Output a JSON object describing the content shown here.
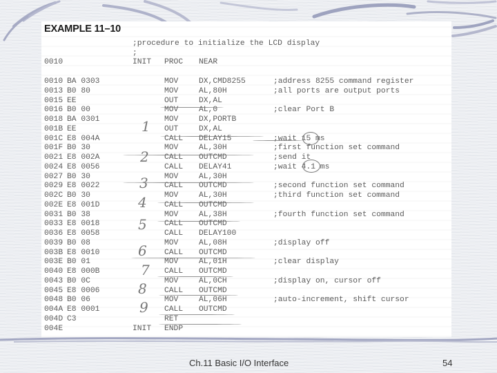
{
  "slide": {
    "example_title": "EXAMPLE 11–10",
    "footer_title": "Ch.11 Basic I/O Interface",
    "page_number": "54"
  },
  "listing": {
    "comment_header": ";procedure to initialize the LCD display",
    "comment_blank": ";",
    "proc_line": {
      "addr": "0010",
      "label": "INIT",
      "op": "PROC",
      "operand": "NEAR"
    },
    "rows": [
      {
        "addr": "0010",
        "code": "BA 0303",
        "op": "MOV",
        "operand": "DX,CMD8255",
        "comment": ";address 8255 command register"
      },
      {
        "addr": "0013",
        "code": "B0 80",
        "op": "MOV",
        "operand": "AL,80H",
        "comment": ";all ports are output ports"
      },
      {
        "addr": "0015",
        "code": "EE",
        "op": "OUT",
        "operand": "DX,AL",
        "comment": ""
      },
      {
        "addr": "0016",
        "code": "B0 00",
        "op": "MOV",
        "operand": "AL,0",
        "comment": ";clear Port B"
      },
      {
        "addr": "0018",
        "code": "BA 0301",
        "op": "MOV",
        "operand": "DX,PORTB",
        "comment": ""
      },
      {
        "addr": "001B",
        "code": "EE",
        "op": "OUT",
        "operand": "DX,AL",
        "comment": ""
      },
      {
        "addr": "001C",
        "code": "E8 004A",
        "op": "CALL",
        "operand": "DELAY15",
        "comment": ";wait 15 ms"
      },
      {
        "addr": "001F",
        "code": "B0 30",
        "op": "MOV",
        "operand": "AL,30H",
        "comment": ";first function set command"
      },
      {
        "addr": "0021",
        "code": "E8 002A",
        "op": "CALL",
        "operand": "OUTCMD",
        "comment": ";send it"
      },
      {
        "addr": "0024",
        "code": "E8 0056",
        "op": "CALL",
        "operand": "DELAY41",
        "comment": ";wait 4.1 ms"
      },
      {
        "addr": "0027",
        "code": "B0 30",
        "op": "MOV",
        "operand": "AL,30H",
        "comment": ""
      },
      {
        "addr": "0029",
        "code": "E8 0022",
        "op": "CALL",
        "operand": "OUTCMD",
        "comment": ";second function set command"
      },
      {
        "addr": "002C",
        "code": "B0 30",
        "op": "MOV",
        "operand": "AL,30H",
        "comment": ";third function set command"
      },
      {
        "addr": "002E",
        "code": "E8 001D",
        "op": "CALL",
        "operand": "OUTCMD",
        "comment": ""
      },
      {
        "addr": "0031",
        "code": "B0 38",
        "op": "MOV",
        "operand": "AL,38H",
        "comment": ";fourth function set command"
      },
      {
        "addr": "0033",
        "code": "E8 0018",
        "op": "CALL",
        "operand": "OUTCMD",
        "comment": ""
      },
      {
        "addr": "0036",
        "code": "E8 0058",
        "op": "CALL",
        "operand": "DELAY100",
        "comment": ""
      },
      {
        "addr": "0039",
        "code": "B0 08",
        "op": "MOV",
        "operand": "AL,08H",
        "comment": ";display off"
      },
      {
        "addr": "003B",
        "code": "E8 0010",
        "op": "CALL",
        "operand": "OUTCMD",
        "comment": ""
      },
      {
        "addr": "003E",
        "code": "B0 01",
        "op": "MOV",
        "operand": "AL,01H",
        "comment": ";clear display"
      },
      {
        "addr": "0040",
        "code": "E8 000B",
        "op": "CALL",
        "operand": "OUTCMD",
        "comment": ""
      },
      {
        "addr": "0043",
        "code": "B0 0C",
        "op": "MOV",
        "operand": "AL,0CH",
        "comment": ";display on, cursor off"
      },
      {
        "addr": "0045",
        "code": "E8 0006",
        "op": "CALL",
        "operand": "OUTCMD",
        "comment": ""
      },
      {
        "addr": "0048",
        "code": "B0 06",
        "op": "MOV",
        "operand": "AL,06H",
        "comment": ";auto-increment, shift cursor"
      },
      {
        "addr": "004A",
        "code": "E8 0001",
        "op": "CALL",
        "operand": "OUTCMD",
        "comment": ""
      },
      {
        "addr": "004D",
        "code": "C3",
        "op": "RET",
        "operand": "",
        "comment": ""
      },
      {
        "addr": "004E",
        "code": "",
        "op": "ENDP",
        "operand": "",
        "comment": "",
        "label": "INIT"
      }
    ]
  },
  "annotations": {
    "step_numbers": [
      "1",
      "2",
      "3",
      "4",
      "5",
      "6",
      "7",
      "8",
      "9"
    ],
    "circled_values": [
      "15",
      "4.1"
    ]
  },
  "colors": {
    "background": "#eceef2",
    "swoosh": "#9ea3bf",
    "listing_text": "#5a5a5a",
    "title_text": "#1a1a1a"
  }
}
